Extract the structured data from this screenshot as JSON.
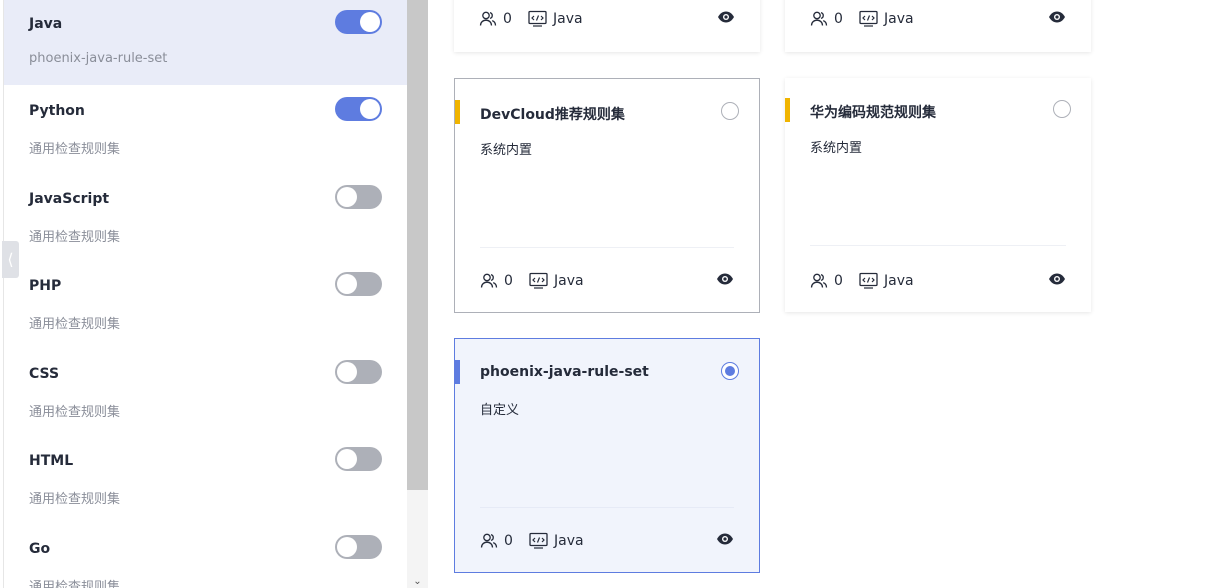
{
  "languages": [
    {
      "name": "Java",
      "desc": "phoenix-java-rule-set",
      "enabled": true,
      "active": true
    },
    {
      "name": "Python",
      "desc": "通用检查规则集",
      "enabled": true,
      "active": false
    },
    {
      "name": "JavaScript",
      "desc": "通用检查规则集",
      "enabled": false,
      "active": false
    },
    {
      "name": "PHP",
      "desc": "通用检查规则集",
      "enabled": false,
      "active": false
    },
    {
      "name": "CSS",
      "desc": "通用检查规则集",
      "enabled": false,
      "active": false
    },
    {
      "name": "HTML",
      "desc": "通用检查规则集",
      "enabled": false,
      "active": false
    },
    {
      "name": "Go",
      "desc": "通用检查规则集",
      "enabled": false,
      "active": false
    }
  ],
  "cards": [
    {
      "title": "",
      "subtitle": "",
      "users": "0",
      "language": "Java",
      "state": "default",
      "bar": "none",
      "partial": true
    },
    {
      "title": "",
      "subtitle": "",
      "users": "0",
      "language": "Java",
      "state": "default",
      "bar": "none",
      "partial": true
    },
    {
      "title": "DevCloud推荐规则集",
      "subtitle": "系统内置",
      "users": "0",
      "language": "Java",
      "state": "outlined",
      "bar": "yellow",
      "checked": false
    },
    {
      "title": "华为编码规范规则集",
      "subtitle": "系统内置",
      "users": "0",
      "language": "Java",
      "state": "default",
      "bar": "yellow",
      "checked": false
    },
    {
      "title": "phoenix-java-rule-set",
      "subtitle": "自定义",
      "users": "0",
      "language": "Java",
      "state": "selected",
      "bar": "blue",
      "checked": true
    }
  ],
  "colors": {
    "accent": "#5e7ce0",
    "bar_yellow": "#f0b400",
    "toggle_off": "#adb0b8"
  },
  "icons": {
    "users": "users-icon",
    "code": "code-icon",
    "view": "eye-icon",
    "collapse": "chevron-left-icon"
  }
}
